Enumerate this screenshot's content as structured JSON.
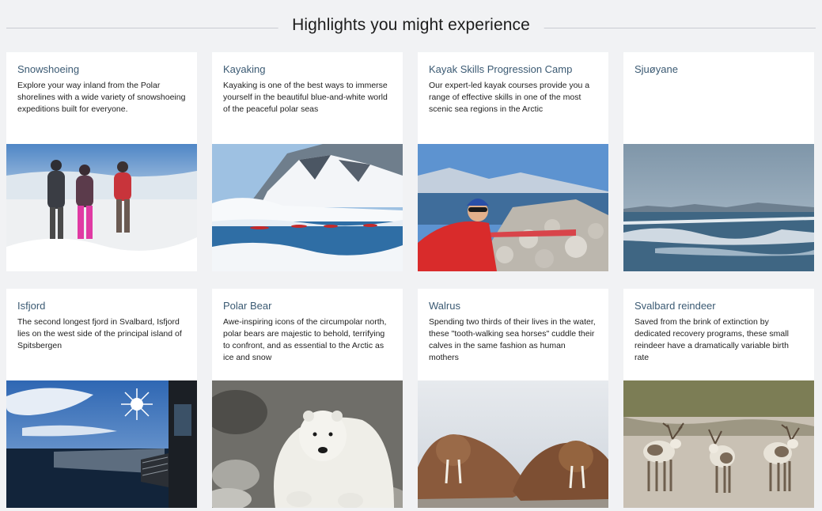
{
  "header": {
    "title": "Highlights you might experience"
  },
  "cards": [
    {
      "title": "Snowshoeing",
      "description": "Explore your way inland from the Polar shorelines with a wide variety of snowshoeing expeditions built for everyone.",
      "image_icon": "snowshoe-hikers-image"
    },
    {
      "title": "Kayaking",
      "description": "Kayaking is one of the best ways to immerse yourself in the beautiful blue-and-white world of the peaceful polar seas",
      "image_icon": "kayakers-glacier-image"
    },
    {
      "title": "Kayak Skills Progression Camp",
      "description": "Our expert-led kayak courses provide you a range of effective skills in one of the most scenic sea regions in the Arctic",
      "image_icon": "kayaker-rocky-shore-image"
    },
    {
      "title": "Sjuøyane",
      "description": "",
      "image_icon": "sea-ice-image"
    },
    {
      "title": "Isfjord",
      "description": "The second longest fjord in Svalbard, Isfjord lies on the west side of the principal island of Spitsbergen",
      "image_icon": "fjord-sun-image"
    },
    {
      "title": "Polar Bear",
      "description": "Awe-inspiring icons of the circumpolar north, polar bears are majestic to behold, terrifying to confront, and as essential to the Arctic as ice and snow",
      "image_icon": "polar-bear-image"
    },
    {
      "title": "Walrus",
      "description": "Spending two thirds of their lives in the water, these \"tooth-walking sea horses\" cuddle their calves in the same fashion as human mothers",
      "image_icon": "walrus-image"
    },
    {
      "title": "Svalbard reindeer",
      "description": "Saved from the brink of extinction by dedicated recovery programs, these small reindeer have a dramatically variable birth rate",
      "image_icon": "reindeer-image"
    }
  ]
}
